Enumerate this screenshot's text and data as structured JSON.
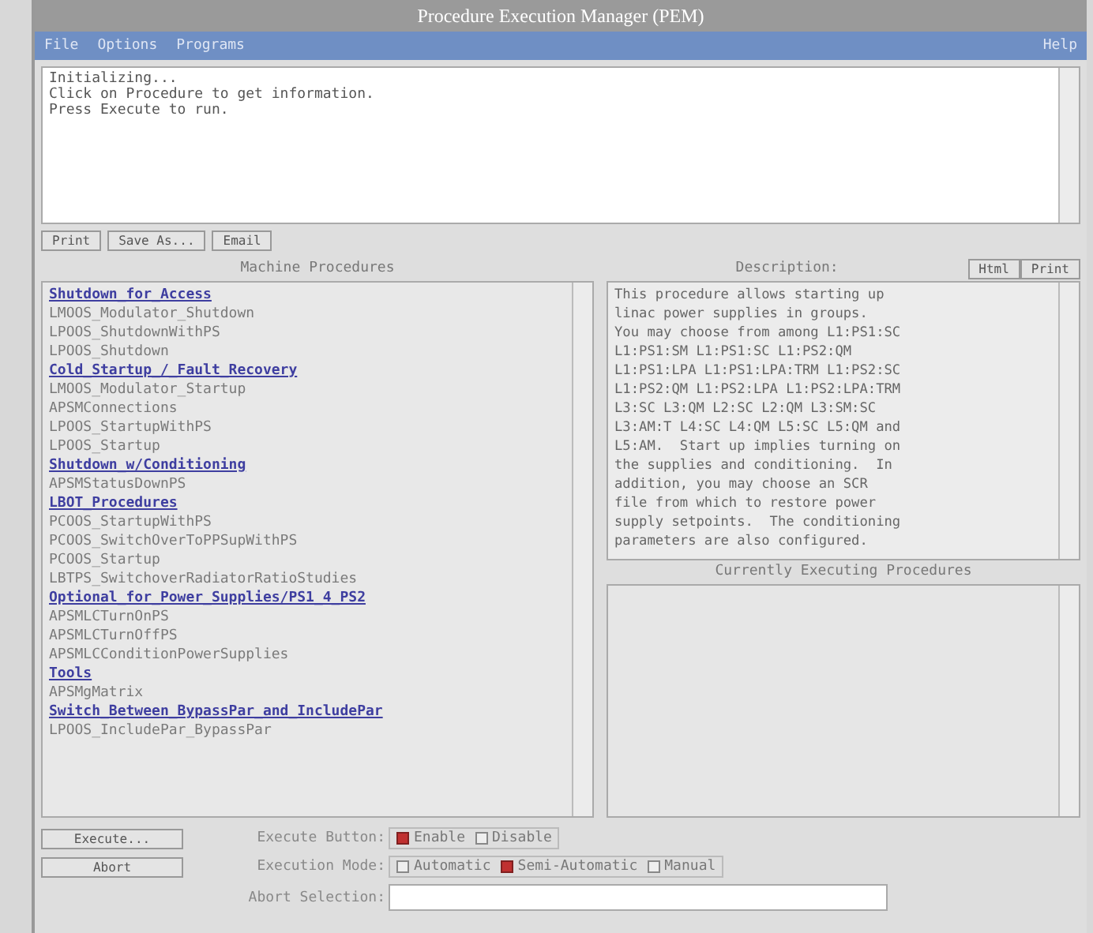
{
  "window": {
    "title": "Procedure Execution Manager (PEM)"
  },
  "menu": [
    {
      "label": "File"
    },
    {
      "label": "Options"
    },
    {
      "label": "Programs"
    }
  ],
  "help_menu": {
    "label": "Help"
  },
  "messages": [
    "Initializing...",
    "Click on Procedure to get information.",
    "Press Execute to run."
  ],
  "message_buttons": [
    "Print",
    "Save As...",
    "Email"
  ],
  "procedures": {
    "title": "Machine Procedures",
    "items": [
      {
        "label": "Shutdown_for_Access",
        "kind": "group"
      },
      {
        "label": "LMOOS_Modulator_Shutdown",
        "kind": "procedure"
      },
      {
        "label": "LPOOS_ShutdownWithPS",
        "kind": "procedure"
      },
      {
        "label": "LPOOS_Shutdown",
        "kind": "procedure"
      },
      {
        "label": "Cold_Startup_/_Fault_Recovery",
        "kind": "group"
      },
      {
        "label": "LMOOS_Modulator_Startup",
        "kind": "procedure"
      },
      {
        "label": "APSMConnections",
        "kind": "procedure"
      },
      {
        "label": "LPOOS_StartupWithPS",
        "kind": "procedure"
      },
      {
        "label": "LPOOS_Startup",
        "kind": "procedure"
      },
      {
        "label": "Shutdown_w/Conditioning",
        "kind": "group"
      },
      {
        "label": "APSMStatusDownPS",
        "kind": "procedure"
      },
      {
        "label": "LBOT_Procedures",
        "kind": "group"
      },
      {
        "label": "PCOOS_StartupWithPS",
        "kind": "procedure"
      },
      {
        "label": "PCOOS_SwitchOverToPPSupWithPS",
        "kind": "procedure"
      },
      {
        "label": "PCOOS_Startup",
        "kind": "procedure"
      },
      {
        "label": "LBTPS_SwitchoverRadiatorRatioStudies",
        "kind": "procedure"
      },
      {
        "label": "Optional_for_Power_Supplies/PS1_4_PS2",
        "kind": "group"
      },
      {
        "label": "APSMLCTurnOnPS",
        "kind": "procedure"
      },
      {
        "label": "APSMLCTurnOffPS",
        "kind": "procedure"
      },
      {
        "label": "APSMLCConditionPowerSupplies",
        "kind": "procedure"
      },
      {
        "label": "Tools",
        "kind": "group"
      },
      {
        "label": "APSMgMatrix",
        "kind": "procedure"
      },
      {
        "label": "Switch_Between_BypassPar_and_IncludePar",
        "kind": "group"
      },
      {
        "label": "LPOOS_IncludePar_BypassPar",
        "kind": "procedure"
      }
    ]
  },
  "description": {
    "title": "Description:",
    "buttons": [
      "Html",
      "Print"
    ],
    "text": "This procedure allows starting up\nlinac power supplies in groups.\nYou may choose from among L1:PS1:SC\nL1:PS1:SM L1:PS1:SC L1:PS2:QM\nL1:PS1:LPA L1:PS1:LPA:TRM L1:PS2:SC\nL1:PS2:QM L1:PS2:LPA L1:PS2:LPA:TRM\nL3:SC L3:QM L2:SC L2:QM L3:SM:SC\nL3:AM:T L4:SC L4:QM L5:SC L5:QM and\nL5:AM.  Start up implies turning on\nthe supplies and conditioning.  In\naddition, you may choose an SCR\nfile from which to restore power\nsupply setpoints.  The conditioning\nparameters are also configured."
  },
  "executing": {
    "title": "Currently Executing Procedures"
  },
  "actions": [
    "Execute...",
    "Abort"
  ],
  "execute_button": {
    "label": "Execute Button:",
    "options": [
      {
        "label": "Enable",
        "selected": true
      },
      {
        "label": "Disable",
        "selected": false
      }
    ]
  },
  "execution_mode": {
    "label": "Execution Mode:",
    "options": [
      {
        "label": "Automatic",
        "selected": false
      },
      {
        "label": "Semi-Automatic",
        "selected": true
      },
      {
        "label": "Manual",
        "selected": false
      }
    ]
  },
  "abort_selection": {
    "label": "Abort Selection:"
  }
}
